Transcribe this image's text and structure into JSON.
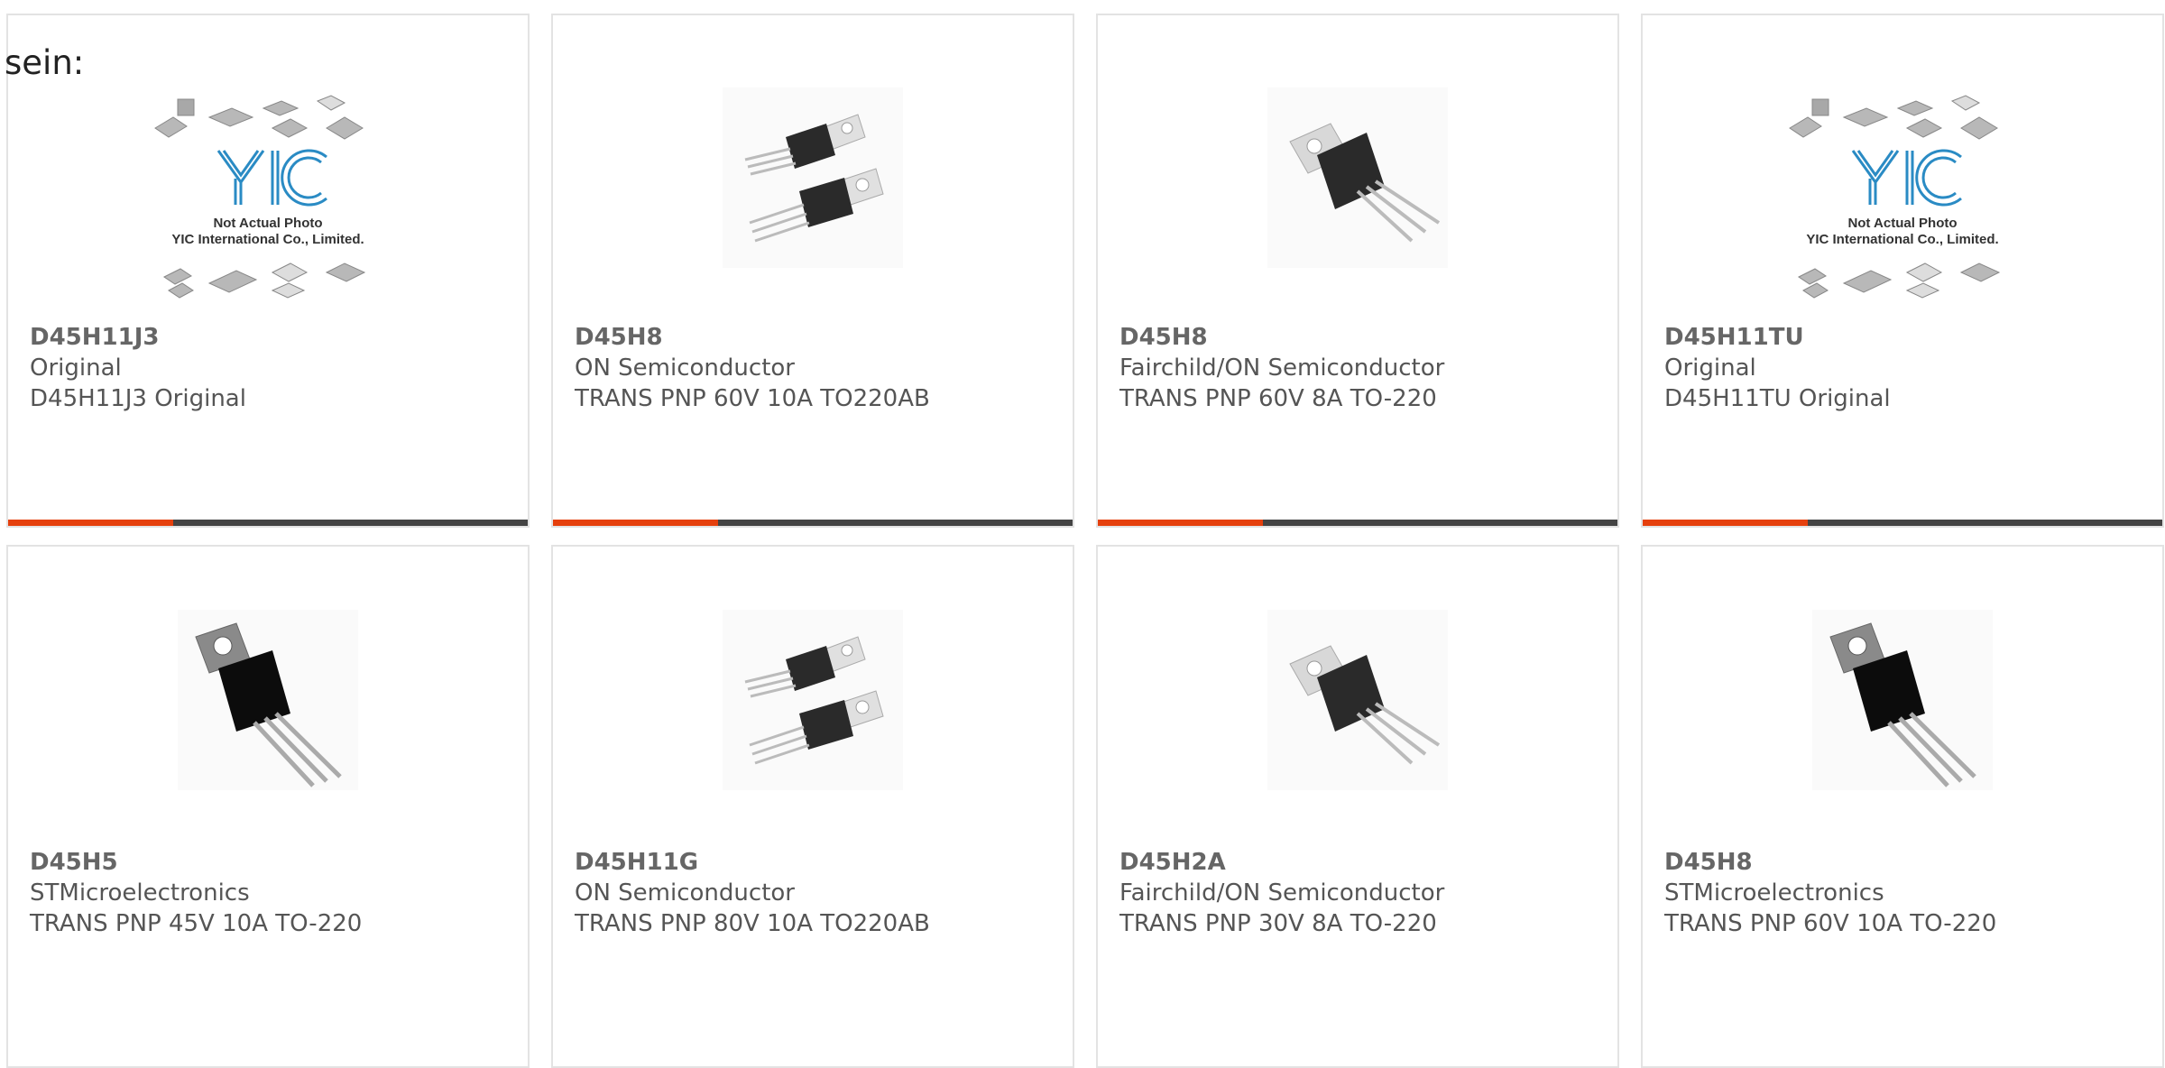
{
  "lead_text": "sein:",
  "brand": {
    "accent": "#e5400d",
    "bar": "#444444"
  },
  "placeholder": {
    "logo": "YIC",
    "line1": "Not Actual Photo",
    "line2": "YIC International Co., Limited."
  },
  "products": [
    {
      "part": "D45H11J3",
      "manufacturer": "Original",
      "description": "D45H11J3 Original",
      "image": "yic-placeholder"
    },
    {
      "part": "D45H8",
      "manufacturer": "ON Semiconductor",
      "description": "TRANS PNP 60V 10A TO220AB",
      "image": "two-to220"
    },
    {
      "part": "D45H8",
      "manufacturer": "Fairchild/ON Semiconductor",
      "description": "TRANS PNP 60V 8A TO-220",
      "image": "single-to220"
    },
    {
      "part": "D45H11TU",
      "manufacturer": "Original",
      "description": "D45H11TU Original",
      "image": "yic-placeholder"
    },
    {
      "part": "D45H5",
      "manufacturer": "STMicroelectronics",
      "description": "TRANS PNP 45V 10A TO-220",
      "image": "st-to220"
    },
    {
      "part": "D45H11G",
      "manufacturer": "ON Semiconductor",
      "description": "TRANS PNP 80V 10A TO220AB",
      "image": "two-to220"
    },
    {
      "part": "D45H2A",
      "manufacturer": "Fairchild/ON Semiconductor",
      "description": "TRANS PNP 30V 8A TO-220",
      "image": "single-to220"
    },
    {
      "part": "D45H8",
      "manufacturer": "STMicroelectronics",
      "description": "TRANS PNP 60V 10A TO-220",
      "image": "st-to220"
    }
  ]
}
